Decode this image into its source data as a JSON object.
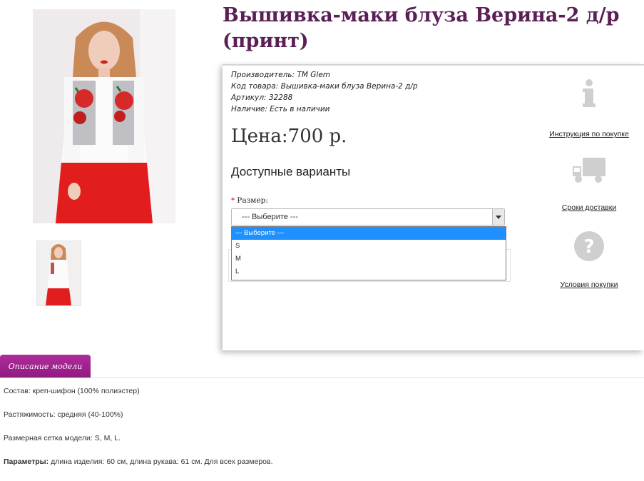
{
  "product": {
    "title": "Вышивка-маки блуза Верина-2 д/р (принт)",
    "specs": [
      {
        "label": "Производитель:",
        "value": "ТМ Glem"
      },
      {
        "label": "Код товара:",
        "value": "Вышивка-маки блуза Верина-2 д/р"
      },
      {
        "label": "Артикул:",
        "value": "32288"
      },
      {
        "label": "Наличие:",
        "value": "Есть в наличии"
      }
    ],
    "price": "Цена:700 р.",
    "variants_heading": "Доступные варианты",
    "size_label": "Размер:",
    "size_required_mark": "*",
    "size_select_value": "--- Выберите ---",
    "size_options": [
      "--- Выберите ---",
      "S",
      "M",
      "L"
    ]
  },
  "side_links": {
    "instruction": "Инструкция по покупке",
    "delivery": "Сроки доставки",
    "conditions": "Условия покупки"
  },
  "tabs": {
    "description_label": "Описание модели"
  },
  "description": {
    "composition_label": "Состав:",
    "composition_value": "креп-шифон (100% полиэстер)",
    "stretch_label": "Растяжимость:",
    "stretch_value": "средняя (40-100%)",
    "sizes_label": "Размерная сетка модели:",
    "sizes_value": "S, M, L.",
    "params_label": "Параметры:",
    "params_value": "длина изделия: 60 см, длина рукава: 61 см. Для всех размеров."
  },
  "colors": {
    "title": "#5a1f55",
    "tab": "#9c2190",
    "dropdown_selected": "#1e90ff",
    "icon_gray": "#cfcfcf"
  },
  "icons": {
    "instruction": "info-icon",
    "delivery": "truck-icon",
    "conditions": "question-icon"
  }
}
